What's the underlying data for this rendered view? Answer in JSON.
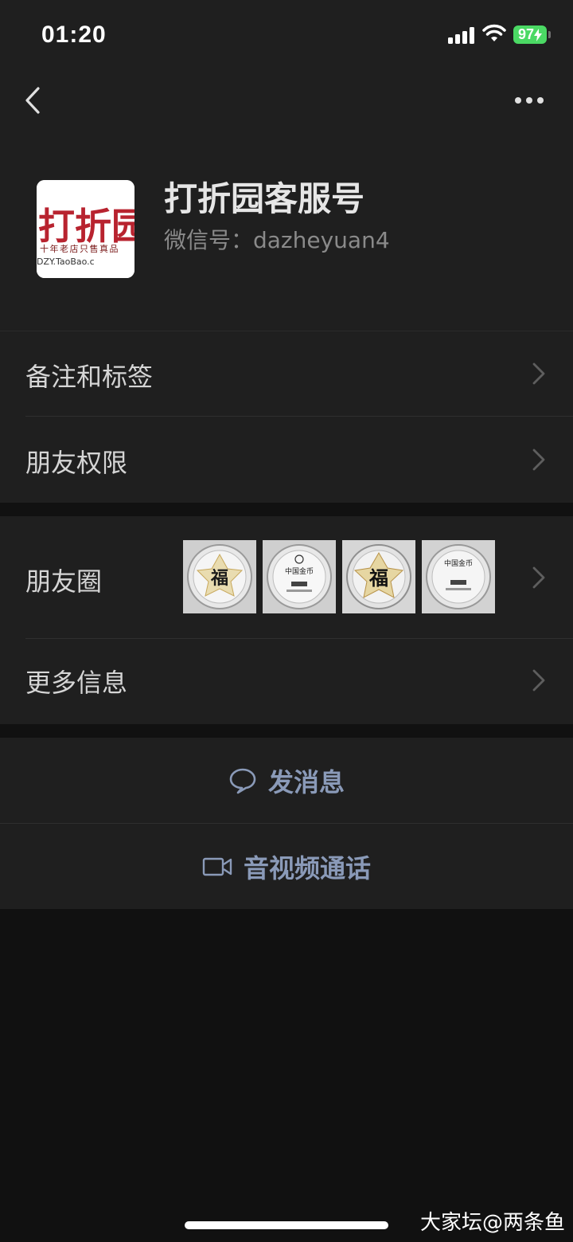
{
  "status_bar": {
    "time": "01:20",
    "battery": "97"
  },
  "profile": {
    "name": "打折园客服号",
    "wechat_id": "微信号：dazheyuan4",
    "avatar_logo_text": "打折园",
    "avatar_slogan": "十年老店只售真品",
    "avatar_url": "DZY.TaoBao.c"
  },
  "menu": {
    "remarks_label": "备注和标签",
    "permissions_label": "朋友权限",
    "moments_label": "朋友圈",
    "more_info_label": "更多信息"
  },
  "moments_thumbnails": [
    {
      "name": "moments-photo-1",
      "glyph": "福"
    },
    {
      "name": "moments-photo-2",
      "glyph": "中国金币"
    },
    {
      "name": "moments-photo-3",
      "glyph": "福"
    },
    {
      "name": "moments-photo-4",
      "glyph": "中国金币"
    }
  ],
  "actions": {
    "send_message_label": "发消息",
    "video_call_label": "音视频通话"
  },
  "watermark": "大家坛@两条鱼",
  "colors": {
    "background": "#111111",
    "card": "#1f1f1f",
    "action_text": "#8a9ab8",
    "battery": "#4bd964"
  }
}
